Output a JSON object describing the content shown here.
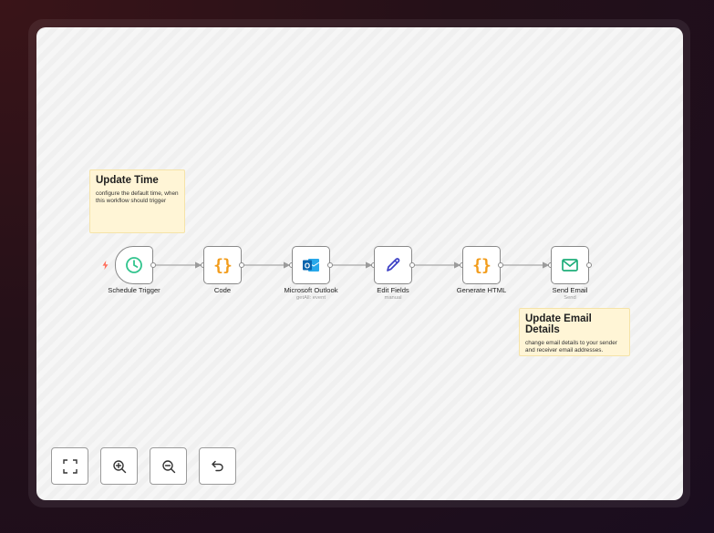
{
  "sticky_notes": [
    {
      "title": "Update Time",
      "body": "configure the default time, when this workflow should trigger"
    },
    {
      "title": "Update Email Details",
      "body": "change email details to your sender and receiver email addresses."
    }
  ],
  "nodes": [
    {
      "label": "Schedule Trigger",
      "subtitle": "",
      "icon": "clock-icon"
    },
    {
      "label": "Code",
      "subtitle": "",
      "icon": "code-braces-icon"
    },
    {
      "label": "Microsoft Outlook",
      "subtitle": "getAll: event",
      "icon": "outlook-icon"
    },
    {
      "label": "Edit Fields",
      "subtitle": "manual",
      "icon": "pencil-icon"
    },
    {
      "label": "Generate HTML",
      "subtitle": "",
      "icon": "code-braces-icon"
    },
    {
      "label": "Send Email",
      "subtitle": "Send",
      "icon": "mail-icon"
    }
  ],
  "glyphs": {
    "braces": "{}"
  },
  "controls": [
    {
      "icon": "fit-view-icon"
    },
    {
      "icon": "zoom-in-icon"
    },
    {
      "icon": "zoom-out-icon"
    },
    {
      "icon": "undo-icon"
    }
  ],
  "colors": {
    "trigger_bolt": "#ff6d5a",
    "clock": "#31c48d",
    "braces": "#f29c1b",
    "outlook": "#0a64ad",
    "pencil": "#3b3fc4",
    "mail": "#1eae7a",
    "sticky_bg": "#fff5d6"
  }
}
